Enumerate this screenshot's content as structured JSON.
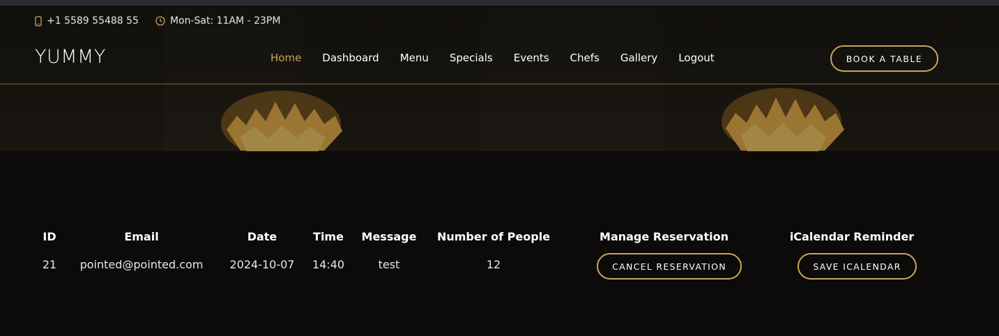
{
  "topbar": {
    "phone": "+1 5589 55488 55",
    "hours": "Mon-Sat: 11AM - 23PM",
    "phone_icon": "phone-icon",
    "clock_icon": "clock-icon"
  },
  "header": {
    "logo": "YUMMY",
    "nav": [
      "Home",
      "Dashboard",
      "Menu",
      "Specials",
      "Events",
      "Chefs",
      "Gallery",
      "Logout"
    ],
    "active_nav": "Home",
    "cta": "BOOK A TABLE"
  },
  "table": {
    "headers": {
      "id": "ID",
      "email": "Email",
      "date": "Date",
      "time": "Time",
      "message": "Message",
      "people": "Number of People",
      "manage": "Manage Reservation",
      "ical": "iCalendar Reminder"
    },
    "rows": [
      {
        "id": "21",
        "email": "pointed@pointed.com",
        "date": "2024-10-07",
        "time": "14:40",
        "message": "test",
        "people": "12",
        "cancel_label": "CANCEL RESERVATION",
        "save_label": "SAVE ICALENDAR"
      }
    ]
  },
  "colors": {
    "accent": "#cda45e",
    "background": "#0c0b09"
  }
}
